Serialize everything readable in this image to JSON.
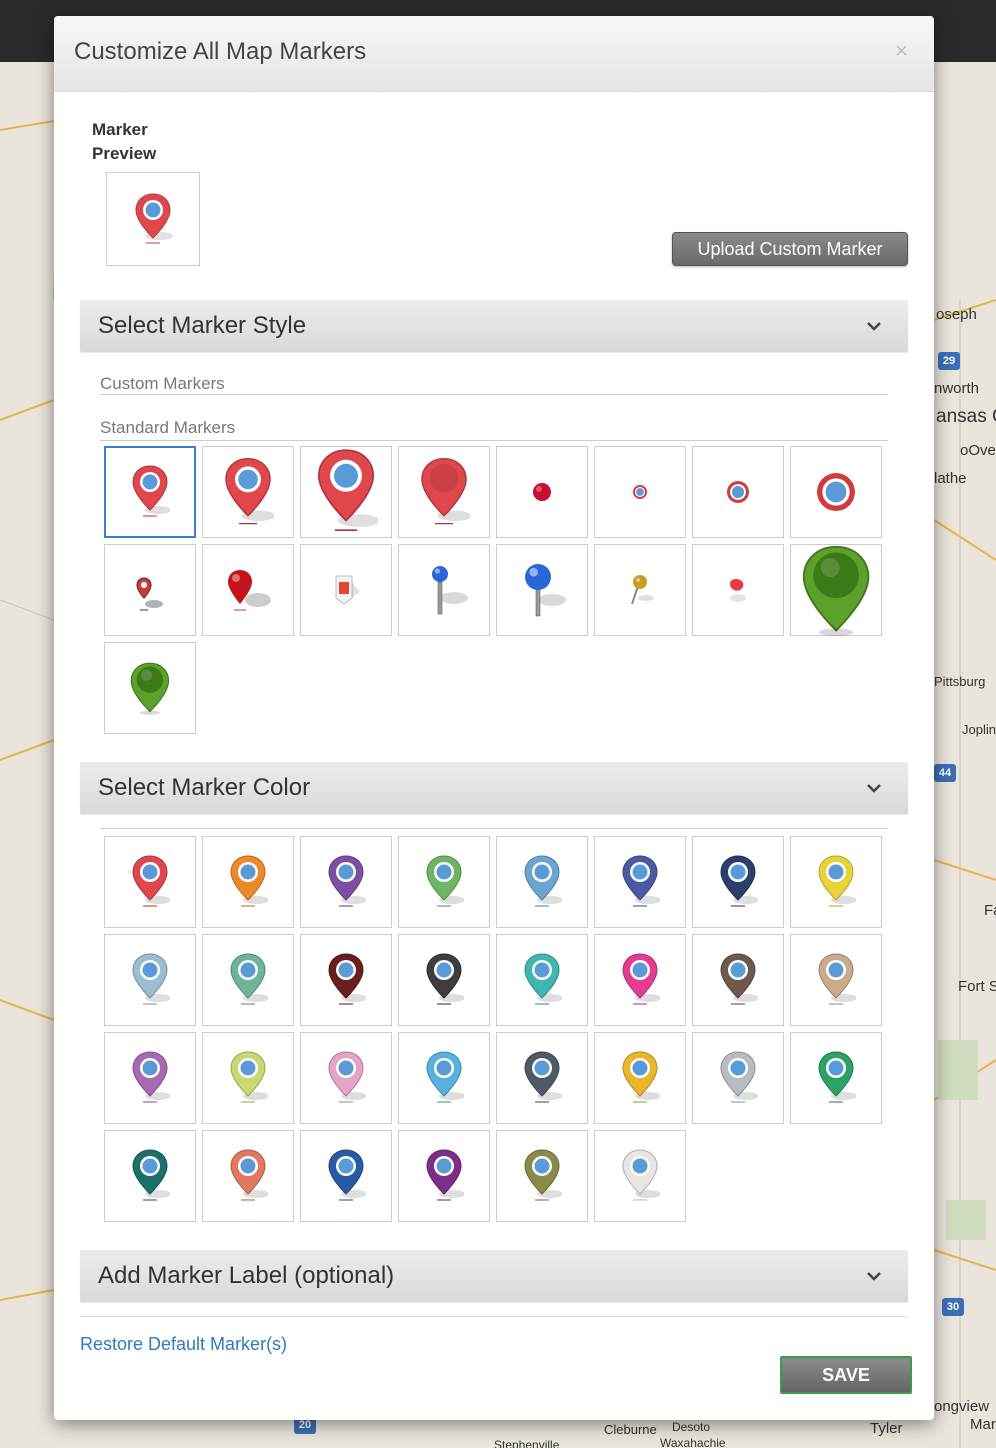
{
  "map": {
    "labels": [
      "oseph",
      "nworth",
      "ansas C",
      "oOve",
      "lathe",
      "Pittsburg",
      "Joplin",
      "Fa",
      "Fort S",
      "ongview",
      "Mar",
      "Tyler",
      "Cleburne",
      "Waxahachie",
      "Stephenville",
      "Desoto"
    ],
    "shields": [
      "29",
      "44",
      "30",
      "20"
    ]
  },
  "modal": {
    "title": "Customize All Map Markers",
    "close_label": "×",
    "preview_label": "Marker Preview",
    "upload_label": "Upload Custom Marker"
  },
  "style_section": {
    "title": "Select Marker Style",
    "custom_label": "Custom Markers",
    "standard_label": "Standard Markers",
    "markers": [
      {
        "type": "pin",
        "color": "#e0474c",
        "size": "s",
        "selected": true
      },
      {
        "type": "pin",
        "color": "#e0474c",
        "size": "m"
      },
      {
        "type": "pin",
        "color": "#e0474c",
        "size": "l"
      },
      {
        "type": "pin-solid",
        "color": "#e0474c",
        "size": "m"
      },
      {
        "type": "dot",
        "color": "#c8102e"
      },
      {
        "type": "ring",
        "color": "#d23b3b",
        "size": "s"
      },
      {
        "type": "ring",
        "color": "#d23b3b",
        "size": "m"
      },
      {
        "type": "ring",
        "color": "#d23b3b",
        "size": "l"
      },
      {
        "type": "pin-shadow",
        "color": "#d23b3b",
        "size": "s"
      },
      {
        "type": "pin-ball",
        "color": "#c4131a",
        "size": "m"
      },
      {
        "type": "flag",
        "color": "#e2482b"
      },
      {
        "type": "pushpin",
        "color": "#2b66d6",
        "size": "s"
      },
      {
        "type": "pushpin",
        "color": "#2b66d6",
        "size": "l"
      },
      {
        "type": "tack",
        "color": "#c5a01f"
      },
      {
        "type": "tack-red",
        "color": "#ea3a46"
      },
      {
        "type": "pin-green",
        "color": "#5da02c",
        "size": "l"
      },
      {
        "type": "pin-green",
        "color": "#5da02c",
        "size": "m"
      }
    ]
  },
  "color_section": {
    "title": "Select Marker Color",
    "colors": [
      "#e0474c",
      "#ec8a2a",
      "#7b4fa1",
      "#6fb662",
      "#6ba5d4",
      "#4b5aa5",
      "#2c3f6b",
      "#e8d43a",
      "#9cbdd0",
      "#6fb39a",
      "#6a1f1f",
      "#3e3e3e",
      "#3fb7ae",
      "#e23d92",
      "#6e5a4c",
      "#c9ad8a",
      "#a968b3",
      "#c9d871",
      "#e4a3c7",
      "#58b0df",
      "#4f5a66",
      "#e8b72c",
      "#b6bcc4",
      "#2da266",
      "#1d6f6a",
      "#e2785e",
      "#2b5aa5",
      "#7c2f8a",
      "#8a8a4a",
      "#e6e6e6"
    ]
  },
  "label_section": {
    "title": "Add Marker Label (optional)"
  },
  "footer": {
    "restore_label": "Restore Default Marker(s)",
    "save_label": "SAVE"
  }
}
